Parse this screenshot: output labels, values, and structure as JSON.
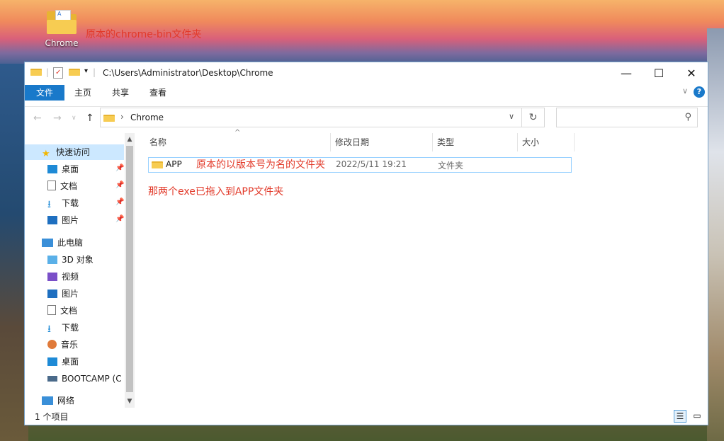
{
  "desktop": {
    "icon_label": "Chrome",
    "note": "原本的chrome-bin文件夹",
    "icon_paper_glyph": "A"
  },
  "window": {
    "title_path": "C:\\Users\\Administrator\\Desktop\\Chrome",
    "controls": {
      "minimize": "—",
      "maximize": "☐",
      "close": "✕"
    }
  },
  "ribbon": {
    "tabs": [
      "文件",
      "主页",
      "共享",
      "查看"
    ],
    "help": "?"
  },
  "address": {
    "crumb": "Chrome",
    "search_placeholder": ""
  },
  "sidebar": {
    "quick_access": "快速访问",
    "quick_items": [
      "桌面",
      "文档",
      "下载",
      "图片"
    ],
    "this_pc": "此电脑",
    "pc_items": [
      "3D 对象",
      "视频",
      "图片",
      "文档",
      "下载",
      "音乐",
      "桌面",
      "BOOTCAMP (C"
    ],
    "network": "网络"
  },
  "columns": [
    "名称",
    "修改日期",
    "类型",
    "大小"
  ],
  "files": [
    {
      "name": "APP",
      "modified": "2022/5/11 19:21",
      "type": "文件夹",
      "size": ""
    }
  ],
  "annotations": {
    "row_note": "原本的以版本号为名的文件夹",
    "below_note": "那两个exe已拖入到APP文件夹"
  },
  "status": {
    "count": "1 个项目"
  },
  "colors": {
    "accent": "#1979ca",
    "annotation": "#e23a2a",
    "folder": "#f7cc52"
  }
}
